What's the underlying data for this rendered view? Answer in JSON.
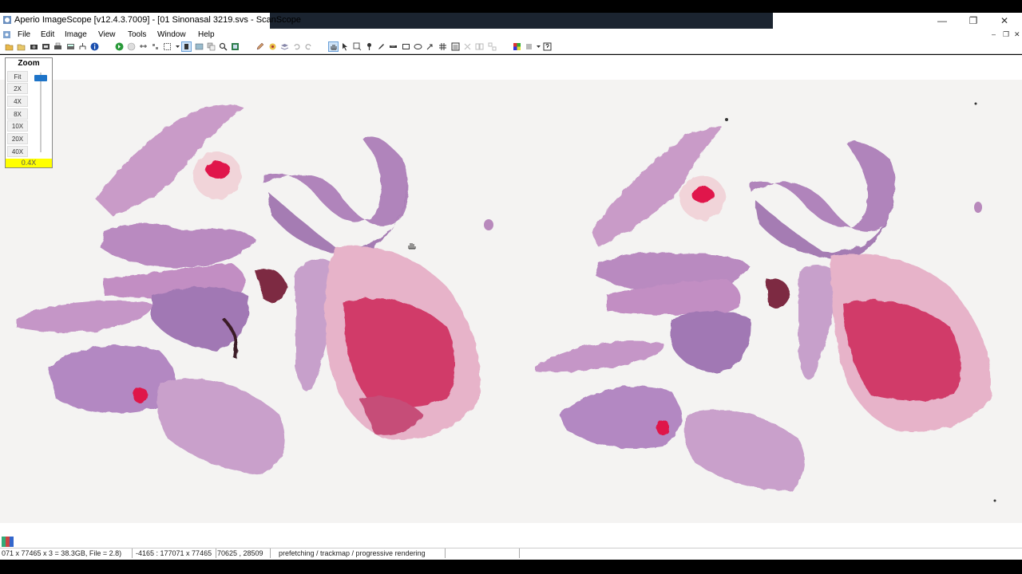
{
  "window": {
    "title": "Aperio ImageScope [v12.4.3.7009] - [01 Sinonasal 3219.svs - ScanScope",
    "minimize": "—",
    "restore": "❐",
    "close": "✕"
  },
  "menu": {
    "items": [
      "File",
      "Edit",
      "Image",
      "View",
      "Tools",
      "Window",
      "Help"
    ],
    "mdi": {
      "minimize": "‒",
      "restore": "❐",
      "close": "✕"
    }
  },
  "zoom": {
    "title": "Zoom",
    "levels": [
      "Fit",
      "2X",
      "4X",
      "8X",
      "10X",
      "20X",
      "40X"
    ],
    "current": "0.4X"
  },
  "status": {
    "dims": "071 x 77465 x 3 = 38.3GB, File = 2.8)",
    "coords": "-4165 : 177071 x 77465",
    "pos": "70625 , 28509",
    "mode": "prefetching / trackmap / progressive rendering"
  },
  "colors": {
    "tissue": "#c98fc4",
    "tissue_dark": "#9c6aa4",
    "blood": "#d4456f",
    "bg": "#f4f3f2"
  }
}
